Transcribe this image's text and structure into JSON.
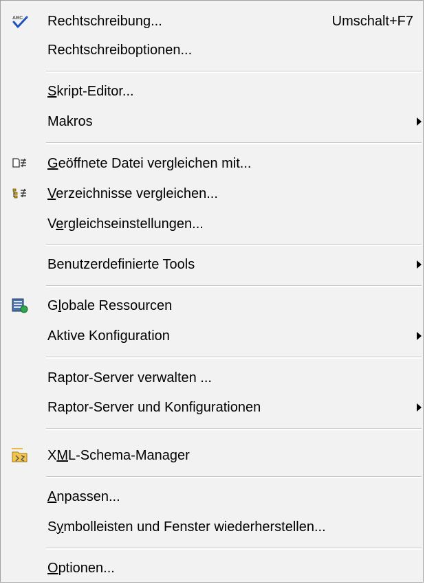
{
  "menu": {
    "items": [
      {
        "label": "Rechtschreibung...",
        "shortcut": "Umschalt+F7",
        "icon": "spellcheck-icon"
      },
      {
        "label": "Rechtschreiboptionen..."
      },
      {
        "label": "Skript-Editor...",
        "underline": "S"
      },
      {
        "label": "Makros",
        "submenu": true
      },
      {
        "label": "Geöffnete Datei vergleichen mit...",
        "underline": "G",
        "icon": "compare-file-icon"
      },
      {
        "label": "Verzeichnisse vergleichen...",
        "underline": "V",
        "icon": "compare-directories-icon"
      },
      {
        "label": "Vergleichseinstellungen...",
        "underline": "e"
      },
      {
        "label": "Benutzerdefinierte Tools",
        "submenu": true
      },
      {
        "label": "Globale Ressourcen",
        "underline": "l",
        "icon": "global-resources-icon"
      },
      {
        "label": "Aktive Konfiguration",
        "submenu": true
      },
      {
        "label": "Raptor-Server verwalten ..."
      },
      {
        "label": "Raptor-Server und Konfigurationen",
        "submenu": true
      },
      {
        "label": "XML-Schema-Manager",
        "underline": "M",
        "icon": "schema-manager-icon"
      },
      {
        "label": "Anpassen...",
        "underline": "A"
      },
      {
        "label": "Symbolleisten und Fenster wiederherstellen...",
        "underline": "y"
      },
      {
        "label": "Optionen...",
        "underline": "O"
      }
    ]
  },
  "colors": {
    "menu_background": "#f2f2f2",
    "separator": "#c9c9c9",
    "text": "#000000"
  }
}
